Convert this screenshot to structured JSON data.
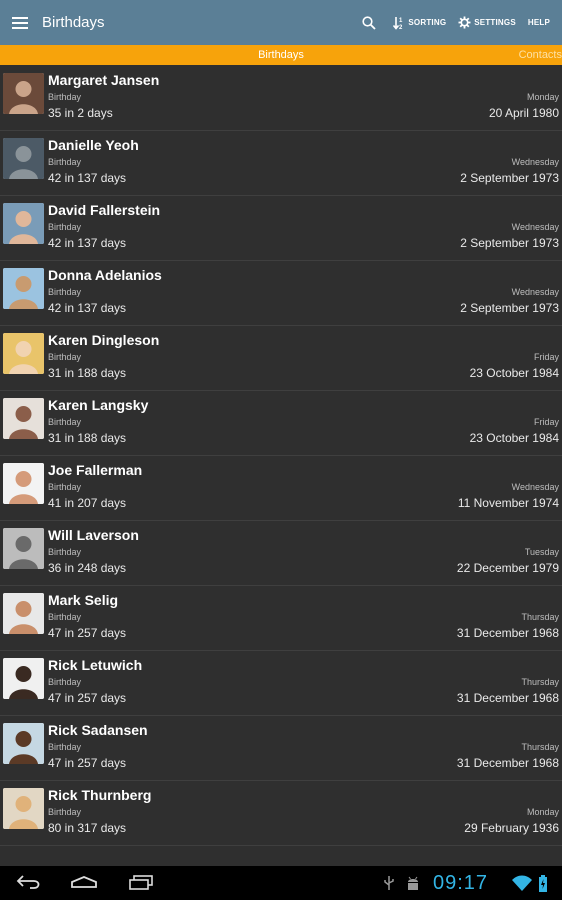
{
  "app_bar": {
    "title": "Birthdays",
    "actions": [
      {
        "label": "SORTING",
        "icon": "sort-icon"
      },
      {
        "label": "SETTINGS",
        "icon": "gear-icon"
      },
      {
        "label": "HELP",
        "icon": ""
      }
    ]
  },
  "tabs": [
    {
      "label": "Birthdays",
      "selected": true
    },
    {
      "label": "Contacts",
      "selected": false
    }
  ],
  "colors": {
    "action_bar": "#5b7f96",
    "tab_strip": "#f7a30b",
    "list_background": "#2f2f2f",
    "clock": "#33b5e5"
  },
  "contacts": [
    {
      "name": "Margaret Jansen",
      "event": "Birthday",
      "age_in": "35 in 2 days",
      "weekday": "Monday",
      "date": "20 April 1980"
    },
    {
      "name": "Danielle Yeoh",
      "event": "Birthday",
      "age_in": "42 in 137 days",
      "weekday": "Wednesday",
      "date": "2 September 1973"
    },
    {
      "name": "David Fallerstein",
      "event": "Birthday",
      "age_in": "42 in 137 days",
      "weekday": "Wednesday",
      "date": "2 September 1973"
    },
    {
      "name": "Donna Adelanios",
      "event": "Birthday",
      "age_in": "42 in 137 days",
      "weekday": "Wednesday",
      "date": "2 September 1973"
    },
    {
      "name": "Karen Dingleson",
      "event": "Birthday",
      "age_in": "31 in 188 days",
      "weekday": "Friday",
      "date": "23 October 1984"
    },
    {
      "name": "Karen Langsky",
      "event": "Birthday",
      "age_in": "31 in 188 days",
      "weekday": "Friday",
      "date": "23 October 1984"
    },
    {
      "name": "Joe Fallerman",
      "event": "Birthday",
      "age_in": "41 in 207 days",
      "weekday": "Wednesday",
      "date": "11 November 1974"
    },
    {
      "name": "Will Laverson",
      "event": "Birthday",
      "age_in": "36 in 248 days",
      "weekday": "Tuesday",
      "date": "22 December 1979"
    },
    {
      "name": "Mark Selig",
      "event": "Birthday",
      "age_in": "47 in 257 days",
      "weekday": "Thursday",
      "date": "31 December 1968"
    },
    {
      "name": "Rick Letuwich",
      "event": "Birthday",
      "age_in": "47 in 257 days",
      "weekday": "Thursday",
      "date": "31 December 1968"
    },
    {
      "name": "Rick Sadansen",
      "event": "Birthday",
      "age_in": "47 in 257 days",
      "weekday": "Thursday",
      "date": "31 December 1968"
    },
    {
      "name": "Rick Thurnberg",
      "event": "Birthday",
      "age_in": "80 in 317 days",
      "weekday": "Monday",
      "date": "29 February 1936"
    }
  ],
  "system_bar": {
    "time": "09:17",
    "nav_buttons": [
      "back-icon",
      "home-icon",
      "recents-icon"
    ],
    "status_icons": [
      "usb-icon",
      "android-debug-icon",
      "wifi-icon",
      "battery-icon"
    ]
  }
}
